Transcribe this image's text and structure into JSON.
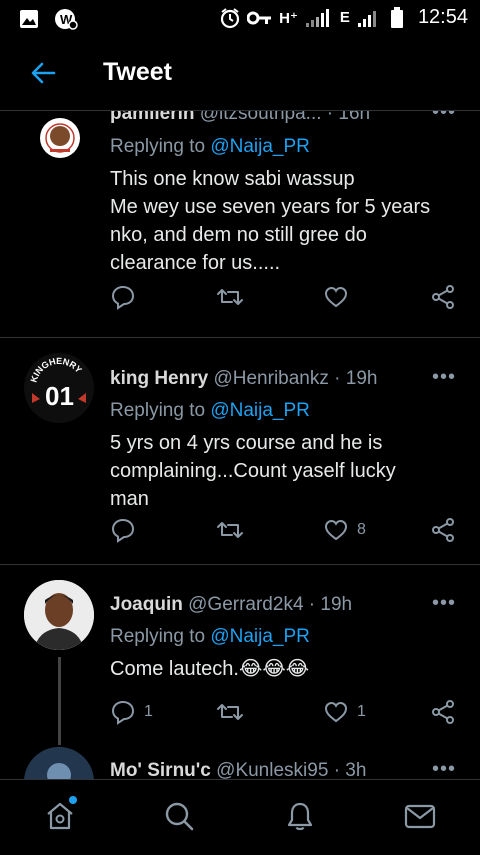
{
  "status_bar": {
    "time": "12:54",
    "network_1": "H⁺",
    "network_2": "E",
    "icons": [
      "image-icon",
      "app-notification-icon",
      "alarm-icon",
      "key-icon",
      "signal-icon",
      "battery-icon"
    ]
  },
  "header": {
    "title": "Tweet",
    "back_icon": "back-arrow-icon"
  },
  "colors": {
    "accent": "#1da1f2",
    "muted": "#8b98a5",
    "background": "#000000",
    "divider": "#2f3336"
  },
  "tweets": [
    {
      "name": "pamilerin",
      "handle": "@itzsouthpa...",
      "dot": "·",
      "time": "16h",
      "replying_prefix": "Replying to",
      "replying_to": "@Naija_PR",
      "lines": [
        "This one know sabi wassup",
        "Me wey use seven years for 5 years",
        "nko, and dem no still gree do",
        "clearance for us....."
      ],
      "reply_count": "",
      "retweet_count": "",
      "like_count": ""
    },
    {
      "name": "king Henry",
      "handle": "@Henribankz",
      "dot": "·",
      "time": "19h",
      "avatar_text_top": "KINGHENRY",
      "avatar_text_number": "01",
      "replying_prefix": "Replying to",
      "replying_to": "@Naija_PR",
      "lines": [
        "5 yrs on 4 yrs course and he is",
        "complaining...Count yaself lucky",
        "man"
      ],
      "reply_count": "",
      "retweet_count": "",
      "like_count": "8"
    },
    {
      "name": "Joaquin",
      "handle": "@Gerrard2k4",
      "dot": "·",
      "time": "19h",
      "replying_prefix": "Replying to",
      "replying_to": "@Naija_PR",
      "lines": [
        "Come lautech.😂😂😂"
      ],
      "reply_count": "1",
      "retweet_count": "",
      "like_count": "1"
    },
    {
      "name": "Mo' Sirnu'c",
      "handle": "@Kunleski95",
      "dot": "·",
      "time": "3h"
    }
  ],
  "more_label": "•••",
  "bottom_nav": [
    "home-icon",
    "search-icon",
    "notifications-icon",
    "messages-icon"
  ]
}
